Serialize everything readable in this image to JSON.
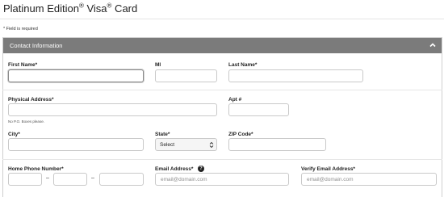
{
  "page": {
    "title_main": "Platinum Edition",
    "title_reg1": "®",
    "title_mid": " Visa",
    "title_reg2": "®",
    "title_end": " Card",
    "required_note": "* Field is required"
  },
  "panel": {
    "title": "Contact Information",
    "collapse_icon": "chevron-up-icon"
  },
  "fields": {
    "first_name": {
      "label": "First Name*",
      "value": ""
    },
    "mi": {
      "label": "MI",
      "value": ""
    },
    "last_name": {
      "label": "Last Name*",
      "value": ""
    },
    "physical_address": {
      "label": "Physical Address*",
      "value": "",
      "hint": "No P.O. Boxes please."
    },
    "apt": {
      "label": "Apt #",
      "value": ""
    },
    "city": {
      "label": "City*",
      "value": ""
    },
    "state": {
      "label": "State*",
      "selected": "Select"
    },
    "zip": {
      "label": "ZIP Code*",
      "value": ""
    },
    "home_phone": {
      "label": "Home Phone Number*",
      "separator": "–"
    },
    "email": {
      "label": "Email Address*",
      "placeholder": "email@domain.com",
      "help_glyph": "?"
    },
    "verify_email": {
      "label": "Verify Email Address*",
      "placeholder": "email@domain.com"
    }
  }
}
